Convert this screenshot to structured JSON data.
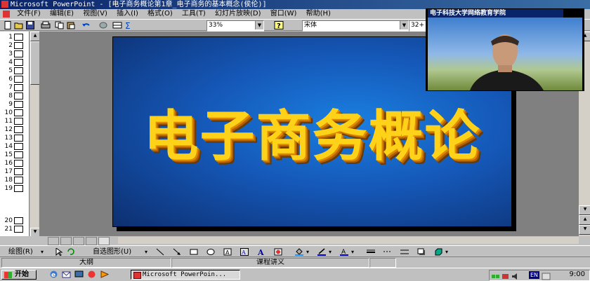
{
  "window": {
    "title": "Microsoft PowerPoint - [电子商务概论第1章_电子商务的基本概念(侯伦)]"
  },
  "menubar": {
    "items": [
      "文件(F)",
      "编辑(E)",
      "视图(V)",
      "插入(I)",
      "格式(O)",
      "工具(T)",
      "幻灯片放映(D)",
      "窗口(W)",
      "帮助(H)"
    ]
  },
  "toolbar": {
    "zoom": "33%",
    "font_name": "宋体",
    "font_size": "32+"
  },
  "outline": {
    "slide_numbers": [
      "1",
      "2",
      "3",
      "4",
      "5",
      "6",
      "7",
      "8",
      "9",
      "10",
      "11",
      "12",
      "13",
      "14",
      "15",
      "16",
      "17",
      "18",
      "19",
      "20",
      "21"
    ]
  },
  "slide": {
    "title": "电子商务概论"
  },
  "video": {
    "caption": "电子科技大学网络教育学院"
  },
  "drawing_toolbar": {
    "draw_label": "绘图(R)",
    "autoshapes_label": "自选图形(U)"
  },
  "statusbar": {
    "outline_label": "大纲",
    "template_label": "课程讲义"
  },
  "taskbar": {
    "start_label": "开始",
    "task_item": "Microsoft PowerPoin...",
    "language": "EN",
    "clock": "9:00"
  },
  "colors": {
    "titlebar": "#0a246a",
    "slide_background": "#1558b8",
    "slide_title": "#ffd21a",
    "chrome": "#c0c0c0"
  }
}
